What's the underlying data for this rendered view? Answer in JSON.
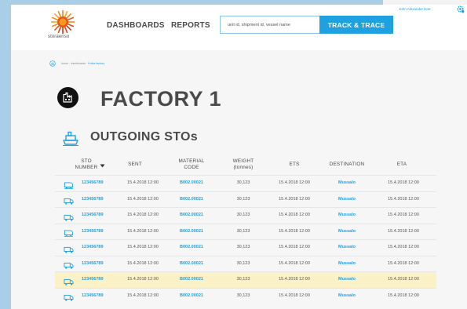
{
  "brand": {
    "logo_text": "storaenso",
    "accent_color": "#1fa0e0"
  },
  "nav": {
    "items": [
      {
        "label": "DASHBOARDS"
      },
      {
        "label": "REPORTS"
      }
    ]
  },
  "search": {
    "placeholder": "unit id, shipment id, vessel name",
    "value": "",
    "button_label": "TRACK & TRACE"
  },
  "user": {
    "name": "John Alexander Doe",
    "icon": "settings-gear-icon"
  },
  "breadcrumb": {
    "icon": "home-icon",
    "home": "home",
    "sep": " · ",
    "dashboards": "dashboards",
    "current": "Kotka factory"
  },
  "page": {
    "title": "FACTORY 1",
    "title_icon": "factory-icon"
  },
  "section": {
    "title": "OUTGOING STOs",
    "icon": "ship-icon"
  },
  "table": {
    "columns": [
      {
        "key": "sto_number",
        "label_line1": "STO",
        "label_line2": "NUMBER",
        "sorted": "desc"
      },
      {
        "key": "sent",
        "label_line1": "SENT",
        "label_line2": ""
      },
      {
        "key": "material_code",
        "label_line1": "MATERIAL",
        "label_line2": "CODE"
      },
      {
        "key": "weight",
        "label_line1": "WEIGHT",
        "label_line2": "(tonnes)"
      },
      {
        "key": "ets",
        "label_line1": "ETS",
        "label_line2": ""
      },
      {
        "key": "destination",
        "label_line1": "DESTINATION",
        "label_line2": ""
      },
      {
        "key": "eta",
        "label_line1": "ETA",
        "label_line2": ""
      }
    ],
    "rows": [
      {
        "transport": "train",
        "sto_number": "123456789",
        "sent": "15.4.2018 12:00",
        "material_code": "B002.00021",
        "weight": "30,123",
        "ets": "15.4.2018 12:00",
        "destination": "Mussalo",
        "eta": "15.4.2018 12:00",
        "highlighted": false
      },
      {
        "transport": "truck",
        "sto_number": "123456789",
        "sent": "15.4.2018 12:00",
        "material_code": "B002.00021",
        "weight": "30,123",
        "ets": "15.4.2018 12:00",
        "destination": "Mussalo",
        "eta": "15.4.2018 12:00",
        "highlighted": false
      },
      {
        "transport": "truck",
        "sto_number": "123456789",
        "sent": "15.4.2018 12:00",
        "material_code": "B002.00021",
        "weight": "30,123",
        "ets": "15.4.2018 12:00",
        "destination": "Mussalo",
        "eta": "15.4.2018 12:00",
        "highlighted": false
      },
      {
        "transport": "train",
        "sto_number": "123456789",
        "sent": "15.4.2018 12:00",
        "material_code": "B002.00021",
        "weight": "30,123",
        "ets": "15.4.2018 12:00",
        "destination": "Mussalo",
        "eta": "15.4.2018 12:00",
        "highlighted": false
      },
      {
        "transport": "truck",
        "sto_number": "123456789",
        "sent": "15.4.2018 12:00",
        "material_code": "B002.00021",
        "weight": "30,123",
        "ets": "15.4.2018 12:00",
        "destination": "Mussalo",
        "eta": "15.4.2018 12:00",
        "highlighted": false
      },
      {
        "transport": "truck",
        "sto_number": "123456789",
        "sent": "15.4.2018 12:00",
        "material_code": "B002.00021",
        "weight": "30,123",
        "ets": "15.4.2018 12:00",
        "destination": "Mussalo",
        "eta": "15.4.2018 12:00",
        "highlighted": false
      },
      {
        "transport": "truck",
        "sto_number": "123456789",
        "sent": "15.4.2018 12:00",
        "material_code": "B002.00021",
        "weight": "30,123",
        "ets": "15.4.2018 12:00",
        "destination": "Mussalo",
        "eta": "15.4.2018 12:00",
        "highlighted": true
      },
      {
        "transport": "truck",
        "sto_number": "123456789",
        "sent": "15.4.2018 12:00",
        "material_code": "B002.00021",
        "weight": "30,123",
        "ets": "15.4.2018 12:00",
        "destination": "Mussalo",
        "eta": "15.4.2018 12:00",
        "highlighted": false
      }
    ]
  }
}
